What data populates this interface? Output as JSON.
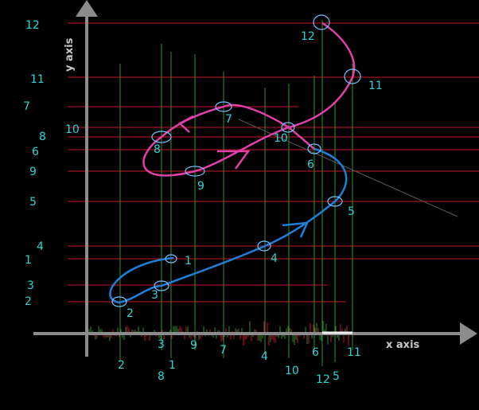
{
  "axes": {
    "x_label": "x axis",
    "y_label": "y axis"
  },
  "colors": {
    "axis": "#8c8c8c",
    "hline": "#c8142a",
    "vline": "#2e8b2e",
    "label": "#2ad4d4",
    "blue_curve": "#1f7fd8",
    "pink_curve": "#e040a8",
    "marker": "#6fc3ff"
  },
  "y_left_labels": [
    "12",
    "11",
    "7",
    "8",
    "6",
    "9",
    "5",
    "4",
    "1",
    "3",
    "2"
  ],
  "y_inner_label": "10",
  "x_axis_labels": [
    "2",
    "8",
    "3",
    "1",
    "9",
    "7",
    "4",
    "10",
    "6",
    "12",
    "5",
    "11"
  ],
  "blue_point_labels": [
    "1",
    "2",
    "3",
    "4",
    "5",
    "6"
  ],
  "pink_point_labels": [
    "7",
    "8",
    "9",
    "10",
    "11",
    "12"
  ]
}
